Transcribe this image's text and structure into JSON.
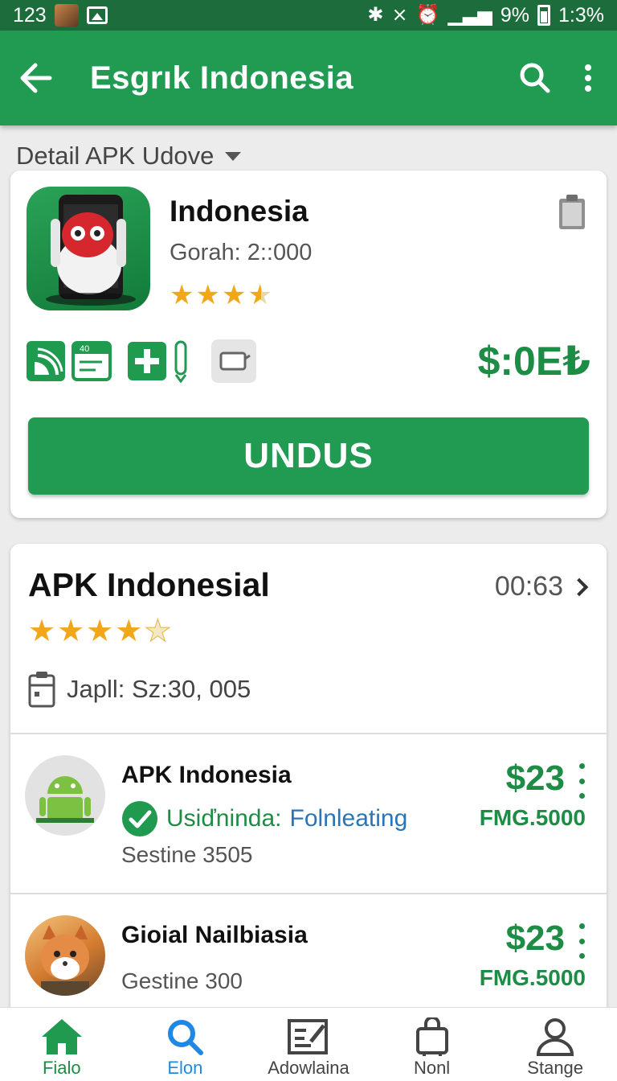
{
  "status_bar": {
    "left_text": "123",
    "battery_text": "9%",
    "time": "1:3%"
  },
  "app_bar": {
    "title": "Esgrık Indonesia"
  },
  "section": {
    "label": "Detail APK Udove"
  },
  "app_card": {
    "name": "Indonesia",
    "meta": "Gorah: 2::000",
    "rating": 3.5,
    "price": "$:0E₺",
    "download_label": "UNDUS",
    "feature_chip_text": "40"
  },
  "detail_card": {
    "title": "APK Indonesial",
    "time": "00:63",
    "rating": 4,
    "date": "Japll: Sz:30, 005",
    "rows": [
      {
        "name": "APK Indonesia",
        "status_a": "Usiďninda:",
        "status_b": "Folnleating",
        "sub": "Sestine 3505",
        "price": "$23",
        "price_sub": "FMG.5000"
      },
      {
        "name": "Gioial Nailbiasia",
        "sub": "Gestine 300",
        "price": "$23",
        "price_sub": "FMG.5000"
      }
    ]
  },
  "bottom_nav": {
    "items": [
      {
        "label": "Fialo"
      },
      {
        "label": "Elon"
      },
      {
        "label": "Adowlaina"
      },
      {
        "label": "Nonl"
      },
      {
        "label": "Stange"
      }
    ]
  },
  "colors": {
    "primary": "#219a52",
    "status_bar": "#1d6d3c",
    "price_green": "#1d8c45",
    "star": "#f2a71b",
    "link_blue": "#2a74b8"
  }
}
